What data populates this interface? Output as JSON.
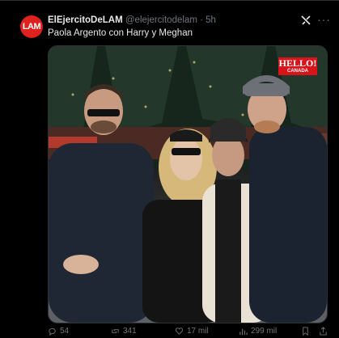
{
  "tweet": {
    "avatar_text": "LAM",
    "display_name": "ElEjercitoDeLAM",
    "handle": "@elejercitodelam",
    "separator": "·",
    "time": "5h",
    "text": "Paola Argento con Harry y Meghan"
  },
  "photo": {
    "watermark": "HELLO!",
    "watermark_sub": "CANADA"
  },
  "actions": {
    "replies": "54",
    "reposts": "341",
    "likes": "17 mil",
    "views": "299 mil"
  },
  "colors": {
    "background": "#000000",
    "text": "#e7e9ea",
    "muted": "#71767b",
    "avatar": "#e0221f"
  }
}
